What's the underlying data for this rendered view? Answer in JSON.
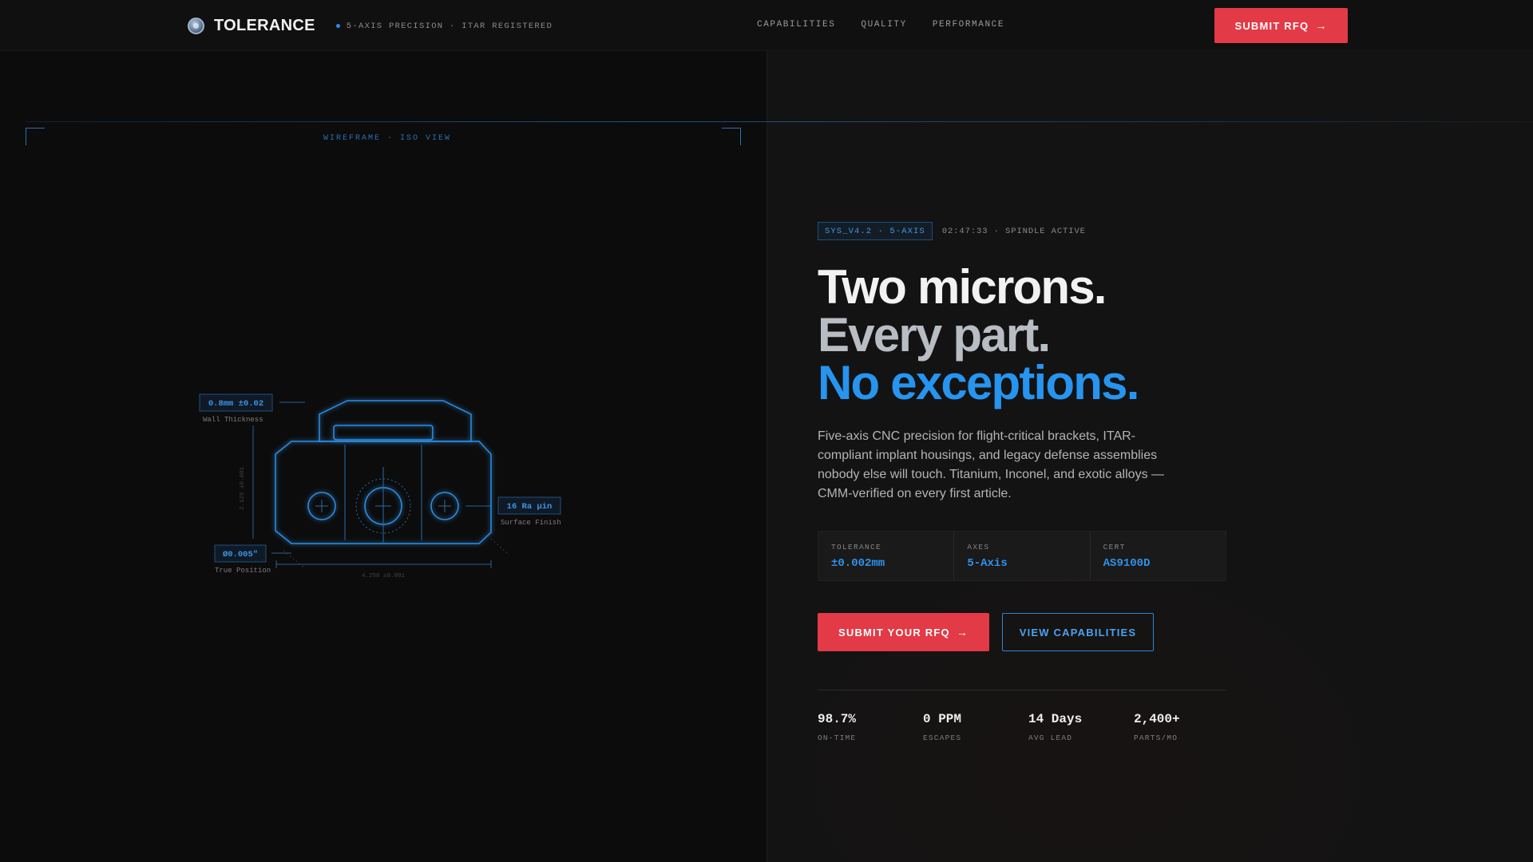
{
  "brand": {
    "name": "TOLERANCE",
    "tagline": "5-AXIS PRECISION · ITAR REGISTERED"
  },
  "nav": {
    "links": [
      "CAPABILITIES",
      "QUALITY",
      "PERFORMANCE"
    ],
    "cta_label": "SUBMIT RFQ"
  },
  "viewer": {
    "label": "WIREFRAME · ISO VIEW",
    "callouts": {
      "wall_value": "0.8mm ±0.02",
      "wall_label": "Wall Thickness",
      "finish_value": "16 Ra µin",
      "finish_label": "Surface Finish",
      "position_value": "Ø0.005\"",
      "position_label": "True Position",
      "height_dim": "2.125 ±0.001",
      "width_dim": "4.250 ±0.001"
    }
  },
  "hero": {
    "badge": "SYS_V4.2 · 5-AXIS",
    "status": "02:47:33 · SPINDLE ACTIVE",
    "headline": [
      "Two microns.",
      "Every part.",
      "No exceptions."
    ],
    "body": "Five-axis CNC precision for flight-critical brackets, ITAR-compliant implant housings, and legacy defense assemblies nobody else will touch. Titanium, Inconel, and exotic alloys — CMM-verified on every first article.",
    "specs": [
      {
        "label": "TOLERANCE",
        "value": "±0.002mm"
      },
      {
        "label": "AXES",
        "value": "5-Axis"
      },
      {
        "label": "CERT",
        "value": "AS9100D"
      }
    ],
    "primary_cta": "SUBMIT YOUR RFQ",
    "secondary_cta": "VIEW CAPABILITIES",
    "stats": [
      {
        "value": "98.7%",
        "label": "ON-TIME"
      },
      {
        "value": "0 PPM",
        "label": "ESCAPES"
      },
      {
        "value": "14 Days",
        "label": "AVG LEAD"
      },
      {
        "value": "2,400+",
        "label": "PARTS/MO"
      }
    ]
  },
  "colors": {
    "accent_blue": "#2794ef",
    "cta_red": "#e23a46",
    "background": "#0c0c0c"
  }
}
